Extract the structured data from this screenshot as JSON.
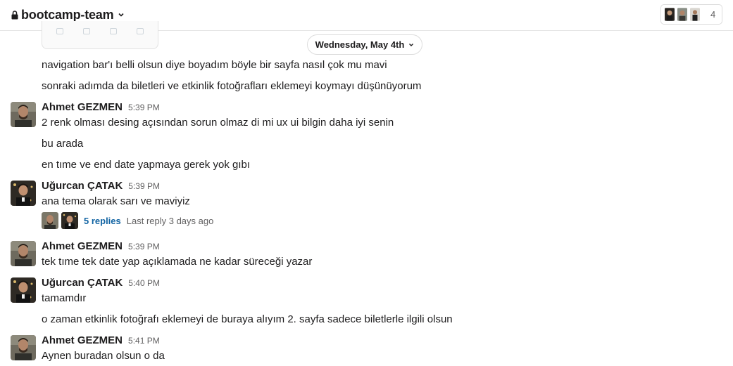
{
  "header": {
    "channel_name": "bootcamp-team",
    "member_count": "4"
  },
  "date_divider": {
    "label": "Wednesday, May 4th"
  },
  "lines": {
    "l1": "navigation bar'ı belli olsun diye boyadım böyle bir sayfa nasıl çok mu mavi",
    "l2": "sonraki adımda da biletleri ve etkinlik fotoğrafları eklemeyi koymayı düşünüyorum"
  },
  "messages": [
    {
      "sender": "Ahmet GEZMEN",
      "time": "5:39 PM",
      "lines": [
        "2 renk olması desing açısından sorun olmaz di mi ux ui bilgin daha iyi senin",
        "bu arada",
        "en tıme ve end date yapmaya gerek yok gıbı"
      ]
    },
    {
      "sender": "Uğurcan ÇATAK",
      "time": "5:39 PM",
      "lines": [
        "ana tema olarak sarı ve maviyiz"
      ]
    },
    {
      "sender": "Ahmet GEZMEN",
      "time": "5:39 PM",
      "lines": [
        "tek tıme tek date yap açıklamada ne kadar süreceği yazar"
      ]
    },
    {
      "sender": "Uğurcan ÇATAK",
      "time": "5:40 PM",
      "lines": [
        "tamamdır",
        "o zaman etkinlik fotoğrafı eklemeyi de buraya alıyım 2. sayfa sadece biletlerle ilgili olsun"
      ]
    },
    {
      "sender": "Ahmet GEZMEN",
      "time": "5:41 PM",
      "lines": [
        "Aynen buradan olsun o da"
      ]
    }
  ],
  "thread": {
    "replies": "5 replies",
    "last_reply": "Last reply 3 days ago"
  },
  "colors": {
    "link": "#1264a3",
    "muted": "#616061",
    "text": "#1d1c1d"
  }
}
